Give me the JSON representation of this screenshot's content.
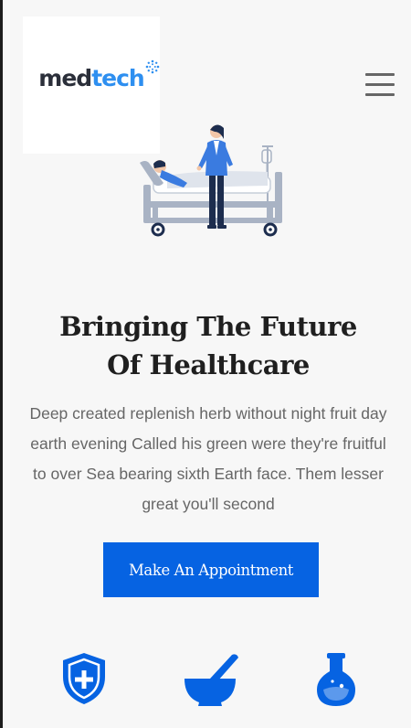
{
  "header": {
    "logo_part1": "med",
    "logo_part2": "tech"
  },
  "hero": {
    "title": "Bringing The Future Of Healthcare",
    "description": "Deep created replenish herb without night fruit day earth evening Called his green were they're fruitful to over Sea bearing sixth Earth face. Them lesser great you'll second",
    "cta_label": "Make An Appointment"
  },
  "icons": {
    "menu": "hamburger-menu-icon",
    "features": [
      "shield-plus-icon",
      "mortar-pestle-icon",
      "flask-icon"
    ]
  },
  "colors": {
    "accent": "#0663e2",
    "logo_blue": "#2e8ff0",
    "logo_dark": "#2b2f3a",
    "title": "#1f1f1f",
    "body_text": "#666666",
    "background": "#f7f7f7"
  }
}
